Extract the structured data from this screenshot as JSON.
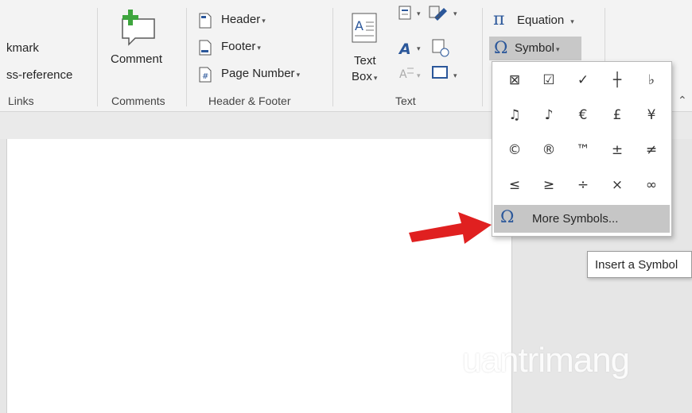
{
  "ribbon": {
    "links": {
      "bookmark_label": "kmark",
      "cross_reference_label": "ss-reference",
      "group_label": "Links"
    },
    "comments": {
      "comment_label": "Comment",
      "group_label": "Comments"
    },
    "header_footer": {
      "header_label": "Header",
      "footer_label": "Footer",
      "page_number_label": "Page Number",
      "group_label": "Header & Footer"
    },
    "text": {
      "text_box_line1": "Text",
      "text_box_line2": "Box",
      "group_label": "Text"
    },
    "symbols": {
      "equation_label": "Equation",
      "symbol_label": "Symbol"
    }
  },
  "symbol_menu": {
    "symbols": [
      "⊠",
      "☑",
      "✓",
      "┼",
      "♭",
      "♫",
      "♪",
      "€",
      "£",
      "¥",
      "©",
      "®",
      "™",
      "±",
      "≠",
      "≤",
      "≥",
      "÷",
      "×",
      "∞"
    ],
    "more_symbols_label": "More Symbols..."
  },
  "tooltip": {
    "text": "Insert a Symbol"
  },
  "watermark": {
    "text": "uantrimang"
  },
  "colors": {
    "accent_blue": "#2b579a",
    "arrow_red": "#e02020"
  }
}
